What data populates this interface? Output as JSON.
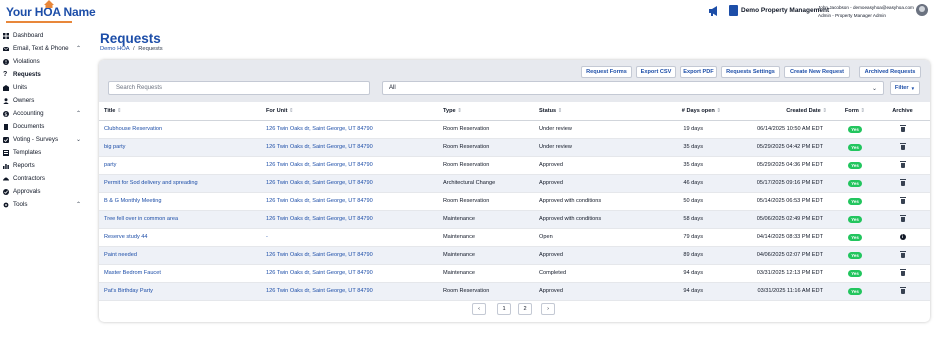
{
  "brand": {
    "logo_text": "Your HOA Name"
  },
  "header": {
    "company_name": "Demo Property Management",
    "user_name": "John Jacobson - demoeasyhoa@easyhoa.com",
    "user_role": "Admin - Property Manager Admin"
  },
  "sidebar": {
    "items": [
      {
        "label": "Dashboard",
        "icon": "dashboard-icon"
      },
      {
        "label": "Email, Text & Phone",
        "icon": "mail-icon",
        "expandable": true
      },
      {
        "label": "Violations",
        "icon": "alert-icon"
      },
      {
        "label": "Requests",
        "icon": "question-icon",
        "active": true
      },
      {
        "label": "Units",
        "icon": "units-icon"
      },
      {
        "label": "Owners",
        "icon": "user-icon"
      },
      {
        "label": "Accounting",
        "icon": "dollar-icon",
        "expandable": true
      },
      {
        "label": "Documents",
        "icon": "document-icon"
      },
      {
        "label": "Voting - Surveys",
        "icon": "check-icon",
        "expandable": true
      },
      {
        "label": "Templates",
        "icon": "template-icon"
      },
      {
        "label": "Reports",
        "icon": "report-icon"
      },
      {
        "label": "Contractors",
        "icon": "contractor-icon"
      },
      {
        "label": "Approvals",
        "icon": "approval-icon"
      },
      {
        "label": "Tools",
        "icon": "gear-icon",
        "expandable": true
      }
    ]
  },
  "page": {
    "title": "Requests",
    "breadcrumb_home": "Demo HOA",
    "breadcrumb_sep": "/",
    "breadcrumb_current": "Requests"
  },
  "toolbar": {
    "request_forms": "Request Forms",
    "export_csv": "Export CSV",
    "export_pdf": "Export PDF",
    "request_settings": "Requests Settings",
    "create_new": "Create New Request",
    "archived": "Archived Requests",
    "search_placeholder": "Search Requests",
    "select_value": "All",
    "filter": "Filter"
  },
  "table": {
    "columns": [
      "Title",
      "For Unit",
      "Type",
      "Status",
      "# Days open",
      "Created Date",
      "Form",
      "Archive"
    ],
    "rows": [
      {
        "title": "Clubhouse Reservation",
        "unit": "126 Twin Oaks dr, Saint George, UT 84790",
        "type": "Room Reservation",
        "status": "Under review",
        "days": "19 days",
        "created": "06/14/2025 10:50 AM EDT",
        "form": "Yes",
        "archive": "trash"
      },
      {
        "title": "big party",
        "unit": "126 Twin Oaks dr, Saint George, UT 84790",
        "type": "Room Reservation",
        "status": "Under review",
        "days": "35 days",
        "created": "05/29/2025 04:42 PM EDT",
        "form": "Yes",
        "archive": "trash"
      },
      {
        "title": "party",
        "unit": "126 Twin Oaks dr, Saint George, UT 84790",
        "type": "Room Reservation",
        "status": "Approved",
        "days": "35 days",
        "created": "05/29/2025 04:36 PM EDT",
        "form": "Yes",
        "archive": "trash"
      },
      {
        "title": "Permit for Sod delivery and spreading",
        "unit": "126 Twin Oaks dr, Saint George, UT 84790",
        "type": "Architectural Change",
        "status": "Approved",
        "days": "46 days",
        "created": "05/17/2025 09:16 PM EDT",
        "form": "Yes",
        "archive": "trash"
      },
      {
        "title": "B & G Monthly Meeting",
        "unit": "126 Twin Oaks dr, Saint George, UT 84790",
        "type": "Room Reservation",
        "status": "Approved with conditions",
        "days": "50 days",
        "created": "05/14/2025 06:53 PM EDT",
        "form": "Yes",
        "archive": "trash"
      },
      {
        "title": "Tree fell over in common area",
        "unit": "126 Twin Oaks dr, Saint George, UT 84790",
        "type": "Maintenance",
        "status": "Approved with conditions",
        "days": "58 days",
        "created": "05/06/2025 02:49 PM EDT",
        "form": "Yes",
        "archive": "trash"
      },
      {
        "title": "Reserve study 44",
        "unit": "-",
        "type": "Maintenance",
        "status": "Open",
        "days": "79 days",
        "created": "04/14/2025 08:33 PM EDT",
        "form": "Yes",
        "archive": "info"
      },
      {
        "title": "Paint needed",
        "unit": "126 Twin Oaks dr, Saint George, UT 84790",
        "type": "Maintenance",
        "status": "Approved",
        "days": "89 days",
        "created": "04/06/2025 02:07 PM EDT",
        "form": "Yes",
        "archive": "trash"
      },
      {
        "title": "Master Bedrom Faucet",
        "unit": "126 Twin Oaks dr, Saint George, UT 84790",
        "type": "Maintenance",
        "status": "Completed",
        "days": "94 days",
        "created": "03/31/2025 12:13 PM EDT",
        "form": "Yes",
        "archive": "trash"
      },
      {
        "title": "Pat's Birthday Party",
        "unit": "126 Twin Oaks dr, Saint George, UT 84790",
        "type": "Room Reservation",
        "status": "Approved",
        "days": "94 days",
        "created": "03/31/2025 11:16 AM EDT",
        "form": "Yes",
        "archive": "trash"
      }
    ]
  },
  "pagination": {
    "prev": "‹",
    "pages": [
      "1",
      "2"
    ],
    "next": "›"
  },
  "colors": {
    "accent": "#1d4ea8",
    "brand_orange": "#e8873a",
    "yes_badge": "#22c55e",
    "alt_row": "#eef1f7"
  }
}
